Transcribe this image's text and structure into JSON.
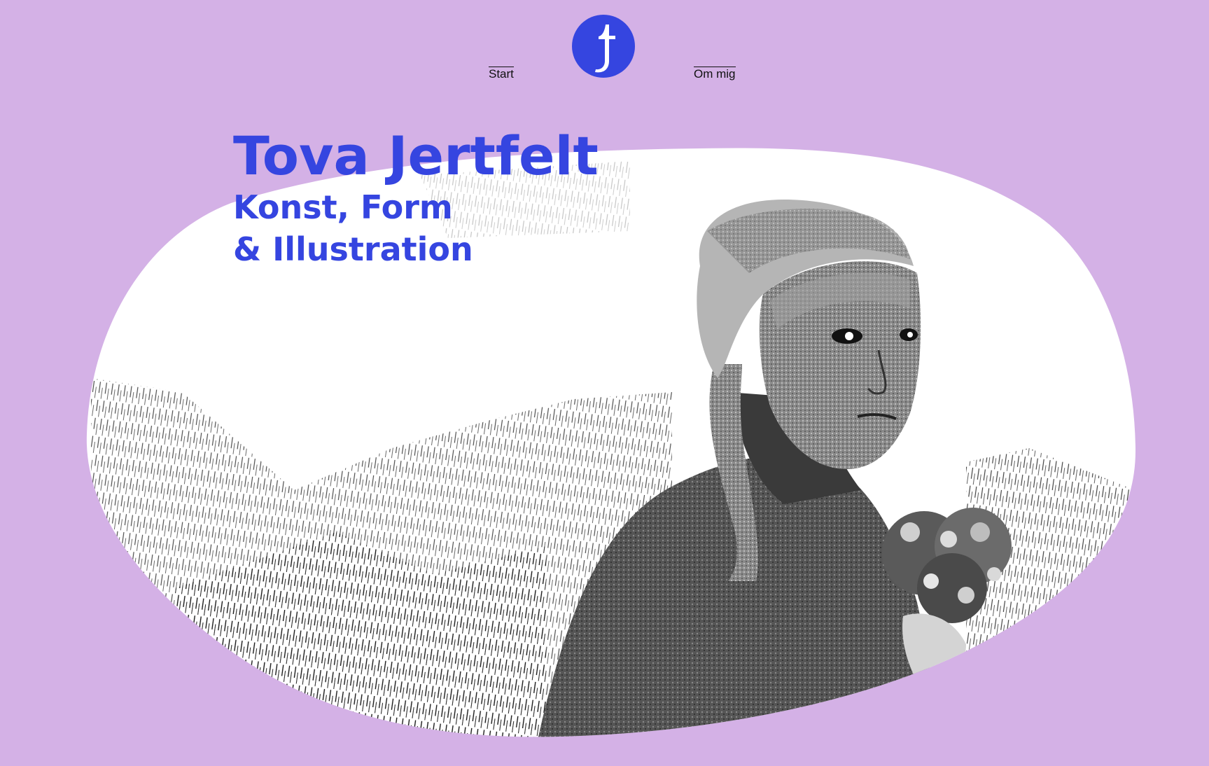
{
  "nav": {
    "start_label": "Start",
    "about_label": "Om mig",
    "logo_letter": "t"
  },
  "hero": {
    "title": "Tova Jertfelt",
    "subtitle": "Konst, Form & Illustration"
  },
  "colors": {
    "background": "#d4b1e6",
    "accent": "#3545e0",
    "blob": "#ffffff"
  },
  "icons": {
    "logo": "t-monogram-circle-logo"
  }
}
